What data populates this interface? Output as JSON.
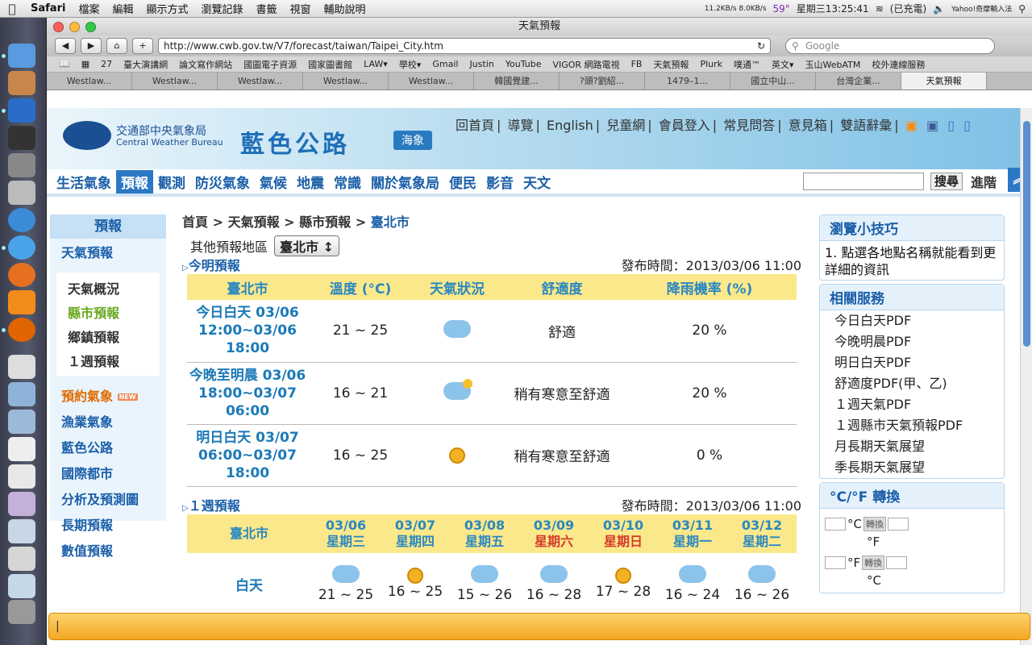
{
  "menubar": {
    "app": "Safari",
    "items": [
      "檔案",
      "編輯",
      "顯示方式",
      "瀏覽記錄",
      "書籤",
      "視窗",
      "輔助說明"
    ],
    "netspeed": "11.2KB/s 8.0KB/s",
    "temp": "59°",
    "clock": "星期三13:25:41",
    "battery": "(已充電)",
    "input": "Yahoo!奇摩輸入法"
  },
  "window": {
    "title": "天氣預報",
    "url": "http://www.cwb.gov.tw/V7/forecast/taiwan/Taipei_City.htm",
    "search_placeholder": "Google"
  },
  "bookmarks": [
    "27",
    "臺大演講網",
    "論文寫作網站",
    "國圖電子資源",
    "國家圖書館",
    "LAW▾",
    "學校▾",
    "Gmail",
    "Justin",
    "YouTube",
    "VIGOR 網路電視",
    "FB",
    "天氣預報",
    "Plurk",
    "噗通™",
    "英文▾",
    "玉山WebATM",
    "校外連線服務"
  ],
  "tabs": [
    "Westlaw...",
    "Westlaw...",
    "Westlaw...",
    "Westlaw...",
    "Westlaw...",
    "韓國覺建...",
    "?頭?劉紹...",
    "1479–1...",
    "國立中山...",
    "台灣企業...",
    "天氣預報"
  ],
  "header": {
    "cwb_cn": "交通部中央氣象局",
    "cwb_en": "Central Weather Bureau",
    "blue_road": "藍色公路",
    "sea": "海象",
    "links": [
      "回首頁",
      "導覽",
      "English",
      "兒童網",
      "會員登入",
      "常見問答",
      "意見箱",
      "雙語辭彙"
    ]
  },
  "nav": {
    "items": [
      "生活氣象",
      "預報",
      "觀測",
      "防災氣象",
      "氣候",
      "地震",
      "常識",
      "關於氣象局",
      "便民",
      "影音",
      "天文"
    ],
    "search_button": "搜尋",
    "advanced": "進階"
  },
  "sidebar": {
    "title": "預報",
    "weather": "天氣預報",
    "sub": [
      "天氣概況",
      "縣市預報",
      "鄉鎮預報",
      "１週預報"
    ],
    "links": [
      "預約氣象",
      "漁業氣象",
      "藍色公路",
      "國際都市",
      "分析及預測圖",
      "長期預報",
      "數值預報"
    ],
    "new_tag": "NEW"
  },
  "breadcrumb": {
    "home": "首頁",
    "weather": "天氣預報",
    "county": "縣市預報",
    "current": "臺北市",
    "sep": ">"
  },
  "region": {
    "label": "其他預報地區",
    "selected": "臺北市"
  },
  "today": {
    "title": "今明預報",
    "publish": "發布時間：2013/03/06 11:00",
    "headers": [
      "臺北市",
      "溫度 (°C)",
      "天氣狀況",
      "舒適度",
      "降雨機率 (%)"
    ],
    "rows": [
      {
        "period": "今日白天 03/06 12:00~03/06 18:00",
        "temp": "21 ~ 25",
        "icon": "cloudy-icon",
        "comfort": "舒適",
        "rain": "20 %"
      },
      {
        "period": "今晚至明晨 03/06 18:00~03/07 06:00",
        "temp": "16 ~ 21",
        "icon": "cloudy-night-icon",
        "comfort": "稍有寒意至舒適",
        "rain": "20 %"
      },
      {
        "period": "明日白天 03/07 06:00~03/07 18:00",
        "temp": "16 ~ 25",
        "icon": "sunny-cloudy-icon",
        "comfort": "稍有寒意至舒適",
        "rain": "0 %"
      }
    ]
  },
  "week": {
    "title": "１週預報",
    "publish": "發布時間：2013/03/06 11:00",
    "city": "臺北市",
    "row_label": "白天",
    "days": [
      {
        "date": "03/06",
        "dow": "星期三",
        "temp": "21 ~ 25",
        "icon": "cloudy-icon"
      },
      {
        "date": "03/07",
        "dow": "星期四",
        "temp": "16 ~ 25",
        "icon": "sunny-cloudy-icon"
      },
      {
        "date": "03/08",
        "dow": "星期五",
        "temp": "15 ~ 26",
        "icon": "partly-sunny-icon"
      },
      {
        "date": "03/09",
        "dow": "星期六",
        "temp": "16 ~ 28",
        "icon": "cloudy-icon"
      },
      {
        "date": "03/10",
        "dow": "星期日",
        "temp": "17 ~ 28",
        "icon": "sunny-cloudy-icon"
      },
      {
        "date": "03/11",
        "dow": "星期一",
        "temp": "16 ~ 24",
        "icon": "rain-icon"
      },
      {
        "date": "03/12",
        "dow": "星期二",
        "temp": "16 ~ 26",
        "icon": "cloudy-icon"
      }
    ]
  },
  "tips": {
    "title": "瀏覽小技巧",
    "num": "1.",
    "text": "點選各地點名稱就能看到更詳細的資訊"
  },
  "services": {
    "title": "相關服務",
    "items": [
      "今日白天PDF",
      "今晚明晨PDF",
      "明日白天PDF",
      "舒適度PDF(甲、乙)",
      "１週天氣PDF",
      "１週縣市天氣預報PDF",
      "月長期天氣展望",
      "季長期天氣展望"
    ]
  },
  "converter": {
    "title": "°C/°F 轉換",
    "c": "°C",
    "f": "°F",
    "button": "轉換"
  },
  "colors": {
    "accent": "#2b78c5",
    "header_yellow": "#fbe88a",
    "weekend": "#d43b2c"
  }
}
